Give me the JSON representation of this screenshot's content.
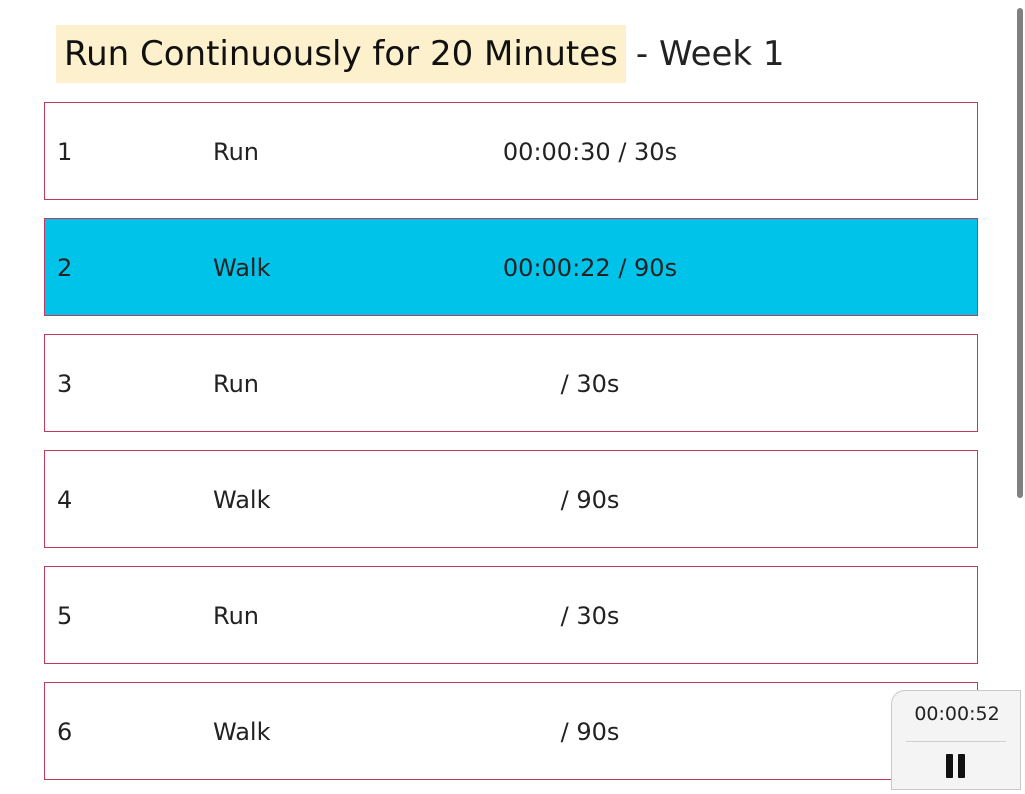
{
  "header": {
    "program_title": "Run Continuously for 20 Minutes",
    "week_label": "- Week 1"
  },
  "intervals": [
    {
      "number": "1",
      "kind": "Run",
      "time": "00:00:30 / 30s",
      "active": false
    },
    {
      "number": "2",
      "kind": "Walk",
      "time": "00:00:22 / 90s",
      "active": true
    },
    {
      "number": "3",
      "kind": "Run",
      "time": "/ 30s",
      "active": false
    },
    {
      "number": "4",
      "kind": "Walk",
      "time": "/ 90s",
      "active": false
    },
    {
      "number": "5",
      "kind": "Run",
      "time": "/ 30s",
      "active": false
    },
    {
      "number": "6",
      "kind": "Walk",
      "time": "/ 90s",
      "active": false
    }
  ],
  "timer": {
    "elapsed": "00:00:52",
    "control_icon": "pause-icon"
  },
  "colors": {
    "title_highlight": "#fdf0cc",
    "active_interval": "#00c3ea",
    "interval_border": "#c0395a"
  }
}
